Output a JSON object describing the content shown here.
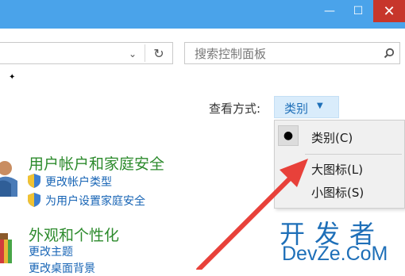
{
  "window": {
    "minimize_glyph": "—",
    "maximize_glyph": "☐",
    "close_glyph": "✕"
  },
  "address_bar": {
    "dropdown_glyph": "⌄",
    "refresh_glyph": "↻"
  },
  "search": {
    "placeholder": "搜索控制面板",
    "icon": "search-icon"
  },
  "view": {
    "label": "查看方式:",
    "selected": "类别",
    "caret": "▼"
  },
  "view_menu": {
    "items": [
      "类别(C)",
      "大图标(L)",
      "小图标(S)"
    ],
    "selected_index": 0
  },
  "sections": [
    {
      "title": "用户帐户和家庭安全",
      "links": [
        "更改帐户类型",
        "为用户设置家庭安全"
      ]
    },
    {
      "title": "外观和个性化",
      "links": [
        "更改主题",
        "更改桌面背景"
      ]
    }
  ],
  "watermark": {
    "line1": "开发者",
    "line2": "DevZe.CoM"
  },
  "colors": {
    "titlebar": "#4aa3ea",
    "close_button": "#c7362b",
    "section_green": "#2d8b2d",
    "link_blue": "#1764b5",
    "arrow_red": "#e8413a"
  }
}
